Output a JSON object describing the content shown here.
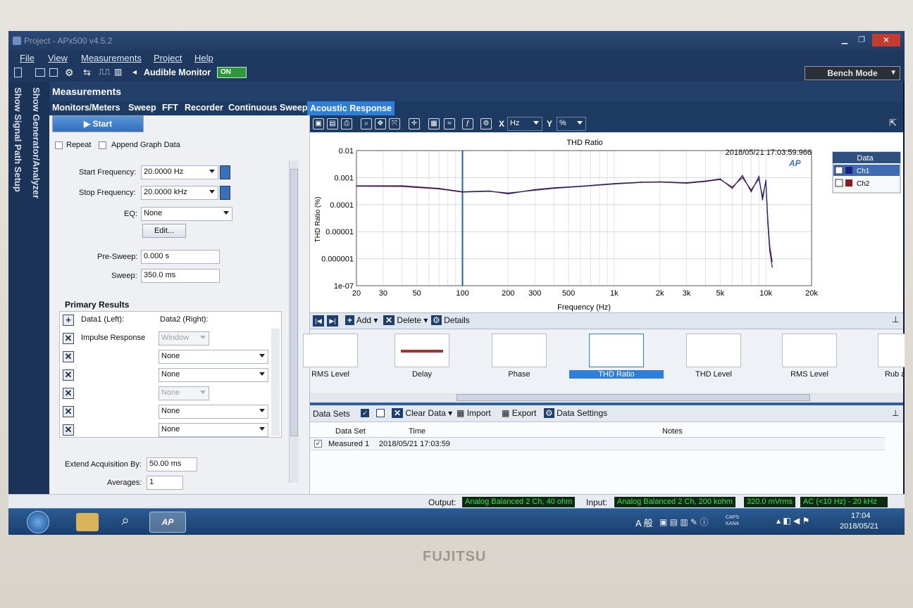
{
  "window": {
    "title": "Project - APx500 v4.5.2"
  },
  "menu": [
    "File",
    "View",
    "Measurements",
    "Project",
    "Help"
  ],
  "toolbar": {
    "audible_monitor": "Audible Monitor",
    "on_label": "ON",
    "bench_mode": "Bench Mode"
  },
  "sidestrip": {
    "generator": "Show Generator/Analyzer",
    "signal_path": "Show Signal Path Setup"
  },
  "measurements_title": "Measurements",
  "tabs": [
    "Monitors/Meters",
    "Sweep",
    "FFT",
    "Recorder",
    "Continuous Sweep",
    "Acoustic Response"
  ],
  "left": {
    "start": "Start",
    "repeat": "Repeat",
    "append": "Append Graph Data",
    "start_freq_label": "Start Frequency:",
    "start_freq": "20.0000 Hz",
    "stop_freq_label": "Stop Frequency:",
    "stop_freq": "20.0000 kHz",
    "eq_label": "EQ:",
    "eq": "None",
    "edit": "Edit...",
    "presweep_label": "Pre-Sweep:",
    "presweep": "0.000 s",
    "sweep_label": "Sweep:",
    "sweep": "350.0 ms",
    "primary_results": "Primary Results",
    "data1": "Data1 (Left):",
    "data2": "Data2 (Right):",
    "rows": [
      {
        "left": "Impulse Response",
        "right": "Window",
        "disabled": true
      },
      {
        "left": "",
        "right": "None",
        "disabled": false
      },
      {
        "left": "",
        "right": "None",
        "disabled": false
      },
      {
        "left": "",
        "right": "None",
        "disabled": true
      },
      {
        "left": "",
        "right": "None",
        "disabled": false
      },
      {
        "left": "",
        "right": "None",
        "disabled": false
      }
    ],
    "extend_label": "Extend Acquisition By:",
    "extend": "50.00 ms",
    "averages_label": "Averages:",
    "averages": "1"
  },
  "graphtools": {
    "x": "X",
    "x_unit": "Hz",
    "y": "Y",
    "y_unit": "%"
  },
  "chart_data": {
    "type": "line",
    "title": "THD Ratio",
    "timestamp": "2018/05/21 17:03:59.966",
    "xlabel": "Frequency (Hz)",
    "ylabel": "THD Ratio (%)",
    "x_scale": "log",
    "y_scale": "log",
    "xlim": [
      20,
      20000
    ],
    "ylim": [
      1e-07,
      0.01
    ],
    "x_ticks": [
      "20",
      "30",
      "50",
      "100",
      "200",
      "300",
      "500",
      "1k",
      "2k",
      "3k",
      "5k",
      "10k",
      "20k"
    ],
    "y_ticks": [
      "0.01",
      "0.001",
      "0.0001",
      "0.00001",
      "0.000001",
      "1e-07"
    ],
    "legend_title": "Data",
    "series": [
      {
        "name": "Ch1",
        "color": "#1a237e",
        "x": [
          20,
          40,
          70,
          100,
          150,
          200,
          300,
          400,
          600,
          1000,
          1500,
          2000,
          3000,
          4000,
          5000,
          6000,
          7000,
          8000,
          9000,
          9500,
          10000,
          10300,
          10600,
          11000
        ],
        "y": [
          0.0005,
          0.0005,
          0.0004,
          0.0003,
          0.00032,
          0.00025,
          0.00036,
          0.00042,
          0.00048,
          0.0006,
          0.00068,
          0.0007,
          0.00065,
          0.00075,
          0.0009,
          0.0004,
          0.0012,
          0.0003,
          0.0011,
          0.00015,
          0.0008,
          2e-05,
          2e-06,
          5e-07
        ]
      },
      {
        "name": "Ch2",
        "color": "#8b1a1a",
        "x": [
          20,
          40,
          70,
          100,
          150,
          200,
          300,
          400,
          600,
          1000,
          1500,
          2000,
          3000,
          4000,
          5000,
          6000,
          7000,
          8000,
          9000,
          9500,
          10000,
          10300,
          10600,
          11000
        ],
        "y": [
          0.00048,
          0.00047,
          0.00038,
          0.00029,
          0.00031,
          0.00027,
          0.00034,
          0.0004,
          0.00047,
          0.00058,
          0.00066,
          0.00068,
          0.00062,
          0.00072,
          0.00085,
          0.00045,
          0.001,
          0.00035,
          0.0009,
          0.0002,
          0.0007,
          3e-05,
          3e-06,
          8e-07
        ]
      }
    ],
    "cursor_x": 100
  },
  "nav": {
    "add": "Add",
    "delete": "Delete",
    "details": "Details"
  },
  "thumbs": [
    "RMS Level",
    "Delay",
    "Phase",
    "THD Ratio",
    "THD Level",
    "RMS Level",
    "Rub and Bu"
  ],
  "datasets": {
    "title": "Data Sets",
    "clear": "Clear Data",
    "import": "Import",
    "export": "Export",
    "settings": "Data Settings",
    "columns": [
      "Data Set",
      "Time",
      "Notes"
    ],
    "rows": [
      {
        "name": "Measured 1",
        "time": "2018/05/21 17:03:59",
        "notes": ""
      }
    ]
  },
  "status": {
    "output_label": "Output:",
    "output": "Analog Balanced 2 Ch, 40 ohm",
    "input_label": "Input:",
    "input": "Analog Balanced 2 Ch, 200 kohm",
    "level": "320.0 mVrms",
    "ac": "AC (<10 Hz) - 20 kHz"
  },
  "taskbar": {
    "ime": "A 般",
    "caps": "CAPS KANA",
    "time": "17:04",
    "date": "2018/05/21"
  },
  "brand": "FUJITSU"
}
